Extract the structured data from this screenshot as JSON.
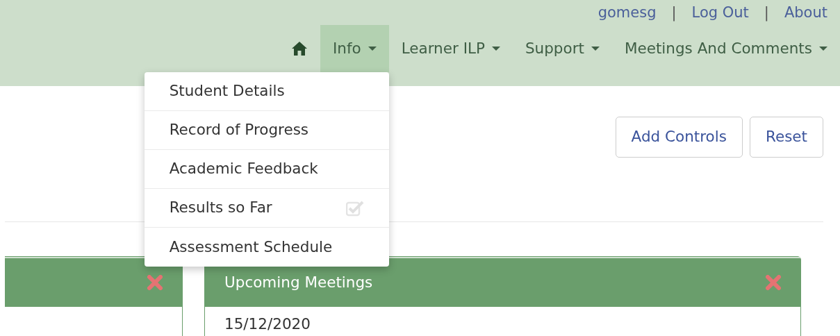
{
  "top_links": [
    {
      "kind": "link",
      "text": "gomesg"
    },
    {
      "kind": "separator",
      "text": "|"
    },
    {
      "kind": "link",
      "text": "Log Out"
    },
    {
      "kind": "separator",
      "text": "|"
    },
    {
      "kind": "link",
      "text": "About"
    }
  ],
  "nav": [
    {
      "kind": "home",
      "selected": false
    },
    {
      "kind": "menu",
      "label": "Info",
      "selected": true,
      "expanded": true
    },
    {
      "kind": "menu",
      "label": "Learner ILP",
      "selected": false,
      "expanded": false
    },
    {
      "kind": "menu",
      "label": "Support",
      "selected": false,
      "expanded": false
    },
    {
      "kind": "menu",
      "label": "Meetings And Comments",
      "selected": false,
      "expanded": false
    }
  ],
  "dropdown": [
    {
      "label": "Student Details",
      "checked": false
    },
    {
      "label": "Record of Progress",
      "checked": false
    },
    {
      "label": "Academic Feedback",
      "checked": false
    },
    {
      "label": "Results so Far",
      "checked": true
    },
    {
      "label": "Assessment Schedule",
      "checked": false
    }
  ],
  "buttons": [
    "Add Controls",
    "Reset"
  ],
  "panels": [
    {
      "closable": true
    },
    {
      "title": "Upcoming Meetings",
      "closable": true,
      "body": [
        "15/12/2020"
      ]
    }
  ]
}
